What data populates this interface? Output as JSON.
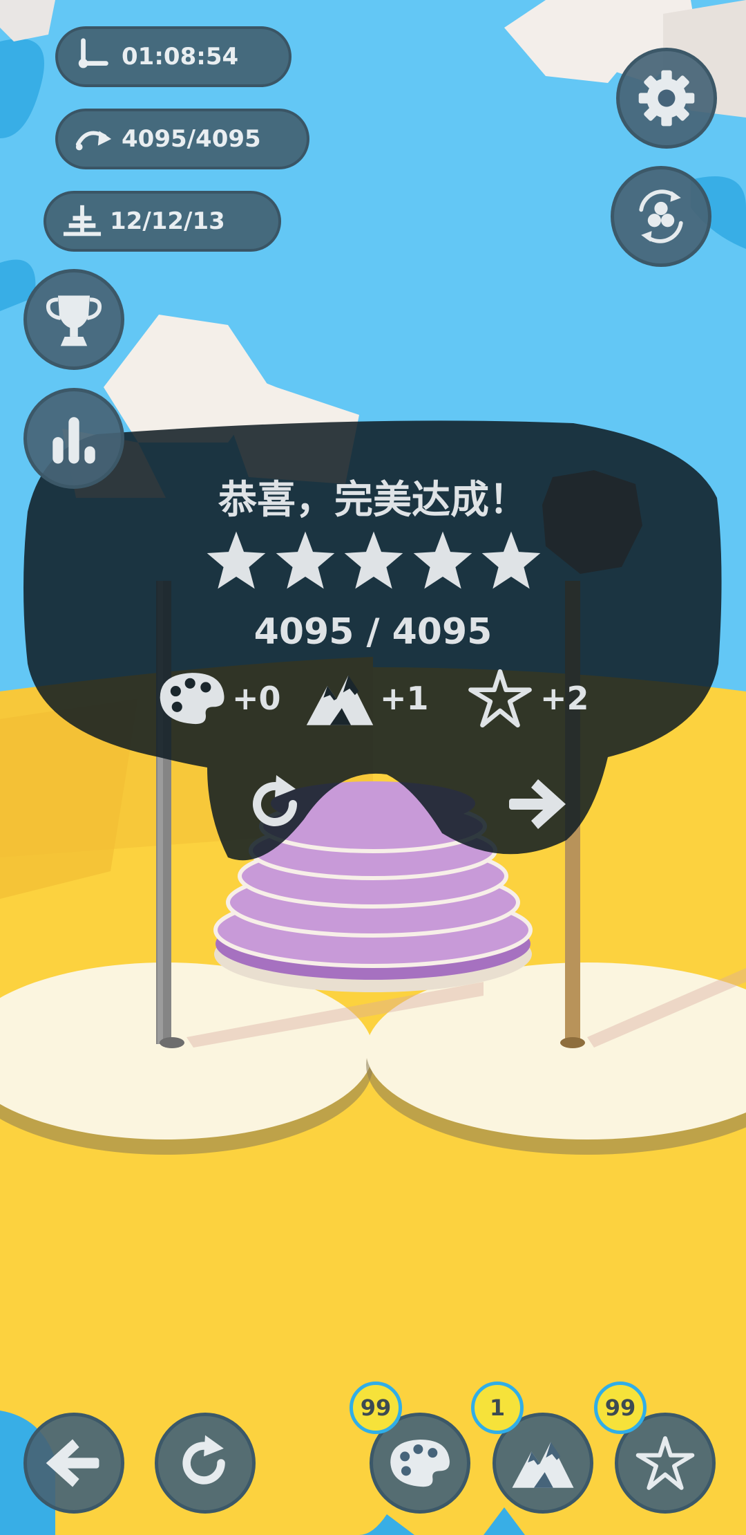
{
  "stats": {
    "time": "01:08:54",
    "moves": "4095/4095",
    "levels": "12/12/13"
  },
  "dialog": {
    "title": "恭喜，完美达成！",
    "stars_earned": 5,
    "stars_total": 5,
    "score": "4095 / 4095",
    "rewards": {
      "palette": "+0",
      "mountain": "+1",
      "star": "+2"
    }
  },
  "inventory": {
    "palette_count": "99",
    "mountain_count": "1",
    "star_count": "99"
  },
  "icons": {
    "time": "timer-icon",
    "moves": "moves-arrow-icon",
    "levels": "tower-icon",
    "settings": "gear-icon",
    "skins": "skins-icon",
    "trophy": "trophy-icon",
    "leaderboard": "bar-chart-icon",
    "back": "arrow-left-icon",
    "restart": "restart-icon"
  },
  "colors": {
    "sky": "#63c7f5",
    "ground": "#fcd23f",
    "disc_pink": "#c89ad8",
    "disc_dark": "#2d2436",
    "badge": "#f6e23a",
    "overlay": "#0f1c23"
  }
}
